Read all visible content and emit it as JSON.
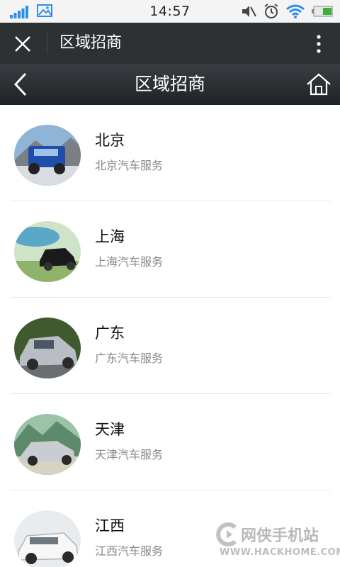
{
  "status_bar": {
    "time": "14:57",
    "icons": [
      "signal-icon",
      "gallery-icon",
      "mute-icon",
      "alarm-icon",
      "wifi-icon",
      "battery-icon"
    ]
  },
  "top_bar": {
    "title": "区域招商",
    "icons": [
      "close-icon",
      "more-icon"
    ]
  },
  "nav_bar": {
    "title": "区域招商",
    "icons": [
      "back-icon",
      "home-icon"
    ]
  },
  "list": [
    {
      "title": "北京",
      "subtitle": "北京汽车服务"
    },
    {
      "title": "上海",
      "subtitle": "上海汽车服务"
    },
    {
      "title": "广东",
      "subtitle": "广东汽车服务"
    },
    {
      "title": "天津",
      "subtitle": "天津汽车服务"
    },
    {
      "title": "江西",
      "subtitle": "江西汽车服务"
    }
  ],
  "watermark": {
    "brand": "网侠手机站",
    "url": "WWW.HACKHOME.COM"
  },
  "colors": {
    "top_bar_bg": "#2e3133",
    "nav_bar_bg": "#2a2d30",
    "subtitle": "#888888",
    "divider": "#e6e6e6"
  }
}
